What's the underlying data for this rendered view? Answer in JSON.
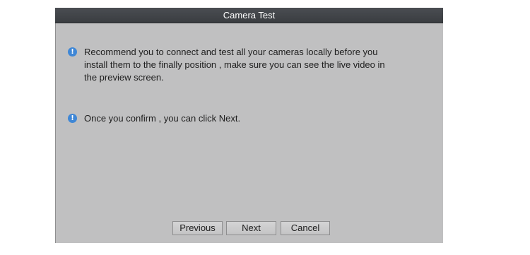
{
  "dialog": {
    "title": "Camera Test",
    "messages": [
      {
        "icon": "info-icon",
        "text": "Recommend you to connect and test all your cameras locally before you install them to the finally position , make sure you can see the live video in the preview screen."
      },
      {
        "icon": "info-icon",
        "text": "Once you confirm , you can click Next."
      }
    ],
    "buttons": {
      "previous": "Previous",
      "next": "Next",
      "cancel": "Cancel"
    },
    "colors": {
      "background": "#c0c0c1",
      "titlebar": "#3f4246",
      "info_icon": "#3f87d6"
    }
  }
}
